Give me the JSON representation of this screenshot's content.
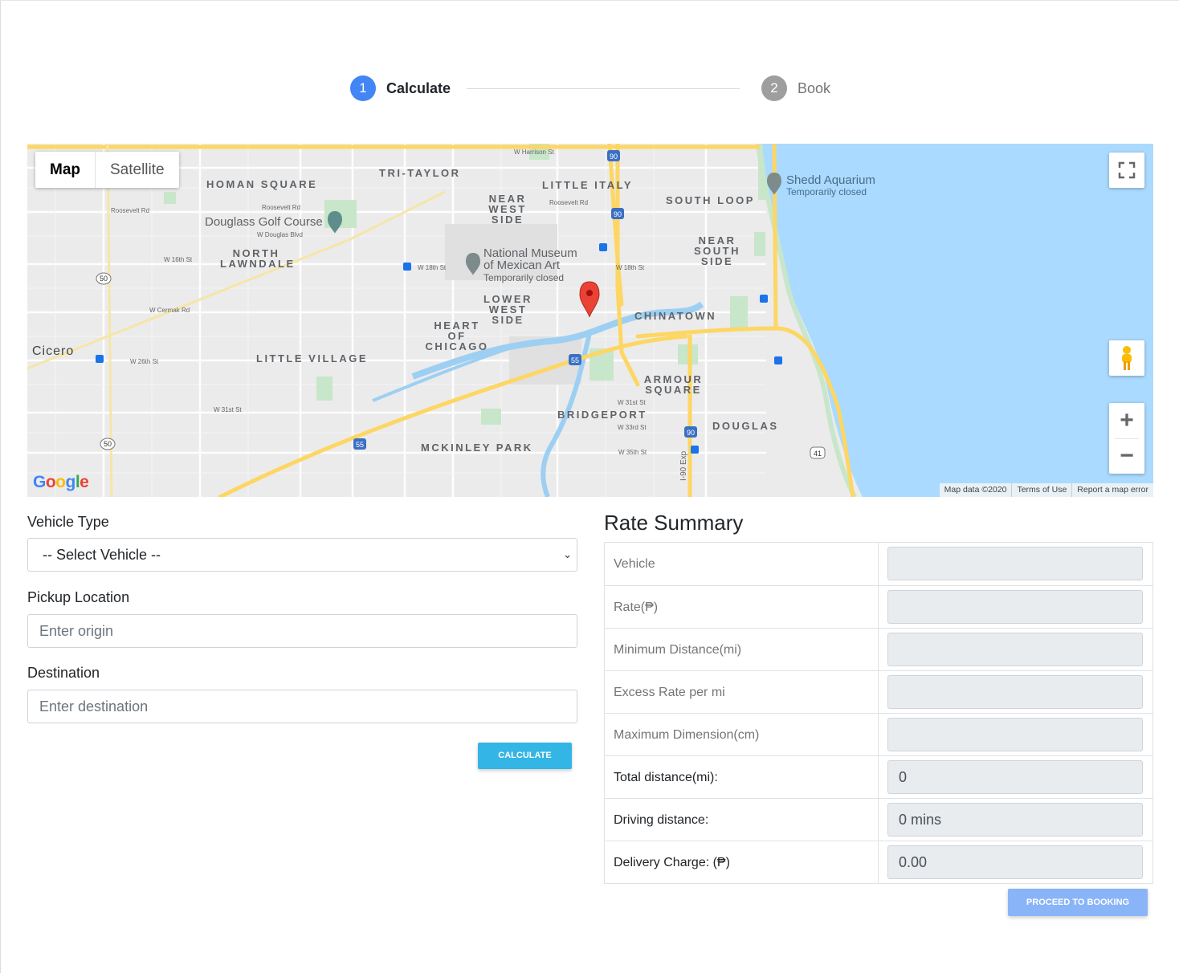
{
  "stepper": {
    "steps": [
      {
        "number": "1",
        "label": "Calculate",
        "state": "active"
      },
      {
        "number": "2",
        "label": "Book",
        "state": "inactive"
      }
    ]
  },
  "map": {
    "type_buttons": {
      "map": "Map",
      "satellite": "Satellite"
    },
    "labels": {
      "homan_square": "HOMAN SQUARE",
      "tri_taylor": "TRI-TAYLOR",
      "little_italy": "LITTLE ITALY",
      "near_west_side": "NEAR WEST SIDE",
      "south_loop": "SOUTH LOOP",
      "near_south_side": "NEAR SOUTH SIDE",
      "north_lawndale": "NORTH LAWNDALE",
      "lower_west_side": "LOWER WEST SIDE",
      "heart_of_chicago": "HEART OF CHICAGO",
      "chinatown": "CHINATOWN",
      "little_village": "LITTLE VILLAGE",
      "armour_square": "ARMOUR SQUARE",
      "bridgeport": "BRIDGEPORT",
      "douglas": "DOUGLAS",
      "mckinley_park": "MCKINLEY PARK",
      "cicero": "Cicero",
      "douglass_golf_course": "Douglass Golf Course",
      "national_museum": "National Museum of Mexican Art",
      "national_museum_status": "Temporarily closed",
      "shedd_aquarium": "Shedd Aquarium",
      "shedd_status": "Temporarily closed",
      "w_harrison": "W Harrison St",
      "roosevelt": "Roosevelt Rd",
      "w_douglas": "W Douglas Blvd",
      "w_16th": "W 16th St",
      "w_18th": "W 18th St",
      "w_cermak": "W Cermak Rd",
      "w_26th": "W 26th St",
      "w_31st": "W 31st St",
      "w_33rd": "W 33rd St",
      "w_35th": "W 35th St",
      "i90": "I-90 Exp"
    },
    "google_logo": "Google",
    "attribution": {
      "data": "Map data ©2020",
      "terms": "Terms of Use",
      "report": "Report a map error"
    },
    "icons": {
      "fullscreen": "fullscreen-icon",
      "pegman": "pegman-icon",
      "zoom_in": "+",
      "zoom_out": "−"
    }
  },
  "form": {
    "vehicle_type": {
      "label": "Vehicle Type",
      "selected": "-- Select Vehicle --"
    },
    "pickup": {
      "label": "Pickup Location",
      "placeholder": "Enter origin"
    },
    "destination": {
      "label": "Destination",
      "placeholder": "Enter destination"
    },
    "calculate_button": "CALCULATE"
  },
  "rate_summary": {
    "title": "Rate Summary",
    "rows": [
      {
        "label": "Vehicle",
        "value": ""
      },
      {
        "label": "Rate(₱)",
        "value": ""
      },
      {
        "label": "Minimum Distance(mi)",
        "value": ""
      },
      {
        "label": "Excess Rate per mi",
        "value": ""
      },
      {
        "label": "Maximum Dimension(cm)",
        "value": ""
      },
      {
        "label": "Total distance(mi):",
        "value": "0"
      },
      {
        "label": "Driving distance:",
        "value": "0 mins"
      },
      {
        "label": "Delivery Charge: (₱)",
        "value": "0.00"
      }
    ],
    "proceed_button": "PROCEED TO BOOKING"
  },
  "colors": {
    "primary": "#4285f4",
    "calc_button": "#33b5e5",
    "proceed_button": "#8ab4f8",
    "marker": "#ea4335",
    "water": "#aadaff"
  }
}
